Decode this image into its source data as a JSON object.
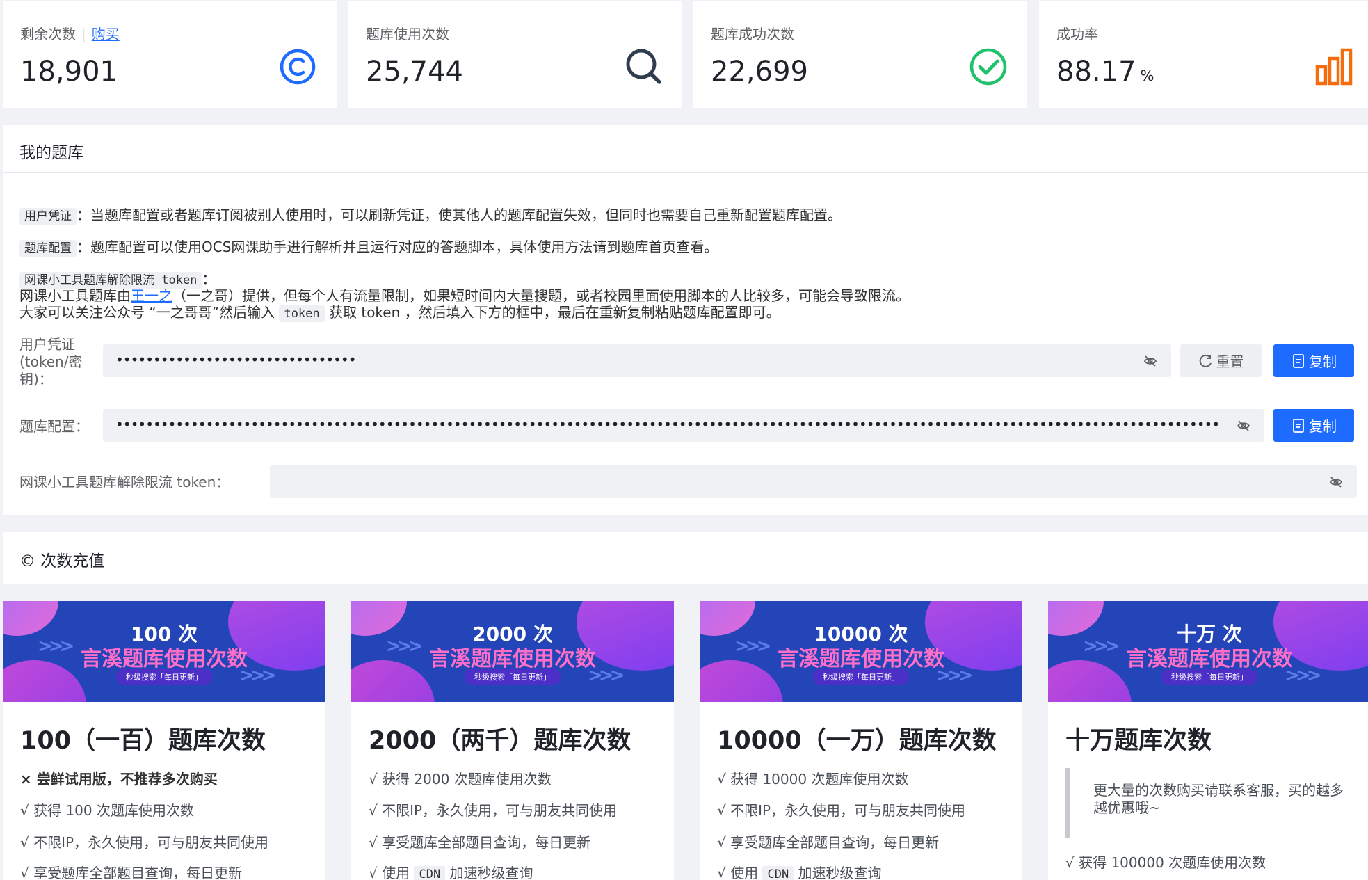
{
  "stats": [
    {
      "label": "剩余次数",
      "link": "购买",
      "value": "18,901",
      "icon": "copyright-icon",
      "color": "#1e6bff"
    },
    {
      "label": "题库使用次数",
      "value": "25,744",
      "icon": "search-icon",
      "color": "#303d4d"
    },
    {
      "label": "题库成功次数",
      "value": "22,699",
      "icon": "check-circle-icon",
      "color": "#1fc16b"
    },
    {
      "label": "成功率",
      "value": "88.17",
      "unit": "%",
      "icon": "bar-chart-icon",
      "color": "#f56c0f"
    }
  ],
  "my_bank": {
    "title": "我的题库",
    "info1": {
      "tag": "用户凭证",
      "text": "：当题库配置或者题库订阅被别人使用时，可以刷新凭证，使其他人的题库配置失效，但同时也需要自己重新配置题库配置。"
    },
    "info2": {
      "tag": "题库配置",
      "text": "：题库配置可以使用OCS网课助手进行解析并且运行对应的答题脚本，具体使用方法请到题库首页查看。"
    },
    "info3": {
      "tag": "网课小工具题库解除限流 token",
      "colon": "：",
      "l1_a": "网课小工具题库由",
      "l1_link": "王一之",
      "l1_b": "（一之哥）提供，但每个人有流量限制，如果短时间内大量搜题，或者校园里面使用脚本的人比较多，可能会导致限流。",
      "l2_a": "大家可以关注公众号 “一之哥哥”然后输入",
      "l2_code": "token",
      "l2_b": "获取 token ，然后填入下方的框中，最后在重新复制粘贴题库配置即可。"
    },
    "token_label": "用户凭证 (token/密钥)：",
    "token_value": "••••••••••••••••••••••••••••••••",
    "reset_label": "重置",
    "copy_label": "复制",
    "config_label": "题库配置：",
    "config_value": "•••••••••••••••••••••••••••••••••••••••••••••••••••••••••••••••••••••••••••••••••••••••••••••••••••••••••••••••••••••••••••••••••••••••••••••••••••",
    "unlimit_label": "网课小工具题库解除限流 token："
  },
  "recharge": {
    "title": "© 次数充值"
  },
  "products": [
    {
      "banner_count": "100 次",
      "banner_title": "言溪题库使用次数",
      "banner_pill": "秒级搜索「每日更新」",
      "name": "100（一百）题库次数",
      "warn": "× 尝鲜试用版，不推荐多次购买",
      "features": [
        "√ 获得 100 次题库使用次数",
        "√ 不限IP，永久使用，可与朋友共同使用",
        "√ 享受题库全部题目查询，每日更新"
      ]
    },
    {
      "banner_count": "2000 次",
      "banner_title": "言溪题库使用次数",
      "banner_pill": "秒级搜索「每日更新」",
      "name": "2000（两千）题库次数",
      "features": [
        "√ 获得 2000 次题库使用次数",
        "√ 不限IP，永久使用，可与朋友共同使用",
        "√ 享受题库全部题目查询，每日更新"
      ],
      "cdn": {
        "a": "√ 使用",
        "code": "CDN",
        "b": "加速秒级查询"
      }
    },
    {
      "banner_count": "10000 次",
      "banner_title": "言溪题库使用次数",
      "banner_pill": "秒级搜索「每日更新」",
      "name": "10000（一万）题库次数",
      "features": [
        "√ 获得 10000 次题库使用次数",
        "√ 不限IP，永久使用，可与朋友共同使用",
        "√ 享受题库全部题目查询，每日更新"
      ],
      "cdn": {
        "a": "√ 使用",
        "code": "CDN",
        "b": "加速秒级查询"
      }
    },
    {
      "banner_count": "十万 次",
      "banner_title": "言溪题库使用次数",
      "banner_pill": "秒级搜索「每日更新」",
      "name": "十万题库次数",
      "quote": "更大量的次数购买请联系客服，买的越多越优惠哦~",
      "features": [
        "√ 获得 100000 次题库使用次数"
      ]
    }
  ]
}
